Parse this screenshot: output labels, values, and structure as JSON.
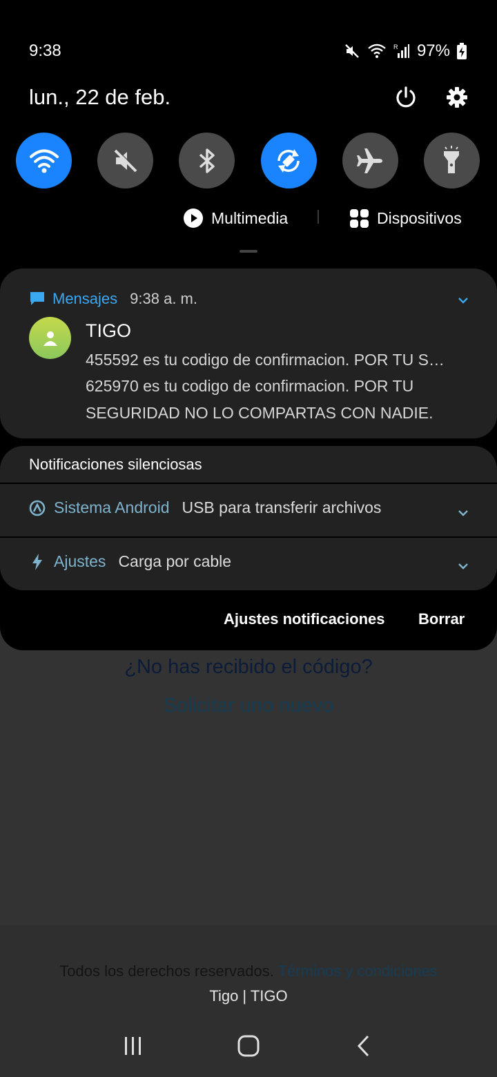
{
  "background_app": {
    "question": "¿No has recibido el código?",
    "request_link": "Solicitar uno nuevo",
    "rights_text": "Todos los derechos reservados.",
    "terms_link": "Términos y condiciones",
    "brand": "Tigo | TIGO"
  },
  "status_bar": {
    "time": "9:38",
    "battery": "97%",
    "icons": [
      "mute-icon",
      "wifi-icon",
      "signal-roaming-icon",
      "battery-charging-icon"
    ]
  },
  "header": {
    "date": "lun., 22 de feb.",
    "icons": [
      "power-icon",
      "gear-icon"
    ]
  },
  "quick_settings": [
    {
      "name": "wifi",
      "on": true
    },
    {
      "name": "sound-mute",
      "on": false
    },
    {
      "name": "bluetooth",
      "on": false
    },
    {
      "name": "auto-rotate",
      "on": true
    },
    {
      "name": "airplane-mode",
      "on": false
    },
    {
      "name": "flashlight",
      "on": false
    }
  ],
  "media": {
    "multimedia_label": "Multimedia",
    "devices_label": "Dispositivos"
  },
  "message_notification": {
    "app": "Mensajes",
    "time": "9:38 a. m.",
    "sender": "TIGO",
    "line1": "455592 es tu codigo de confirmacion. POR TU S…",
    "line2": "625970 es tu codigo de confirmacion. POR TU",
    "line3": "SEGURIDAD NO LO COMPARTAS CON NADIE."
  },
  "silent": {
    "title": "Notificaciones silenciosas",
    "items": [
      {
        "app": "Sistema Android",
        "text": "USB para transferir archivos"
      },
      {
        "app": "Ajustes",
        "text": "Carga por cable"
      }
    ]
  },
  "actions": {
    "settings": "Ajustes notificaciones",
    "clear": "Borrar"
  },
  "colors": {
    "accent": "#1a84ff",
    "messages_blue": "#3ba9f2",
    "tile_off": "#4a4a4a"
  }
}
